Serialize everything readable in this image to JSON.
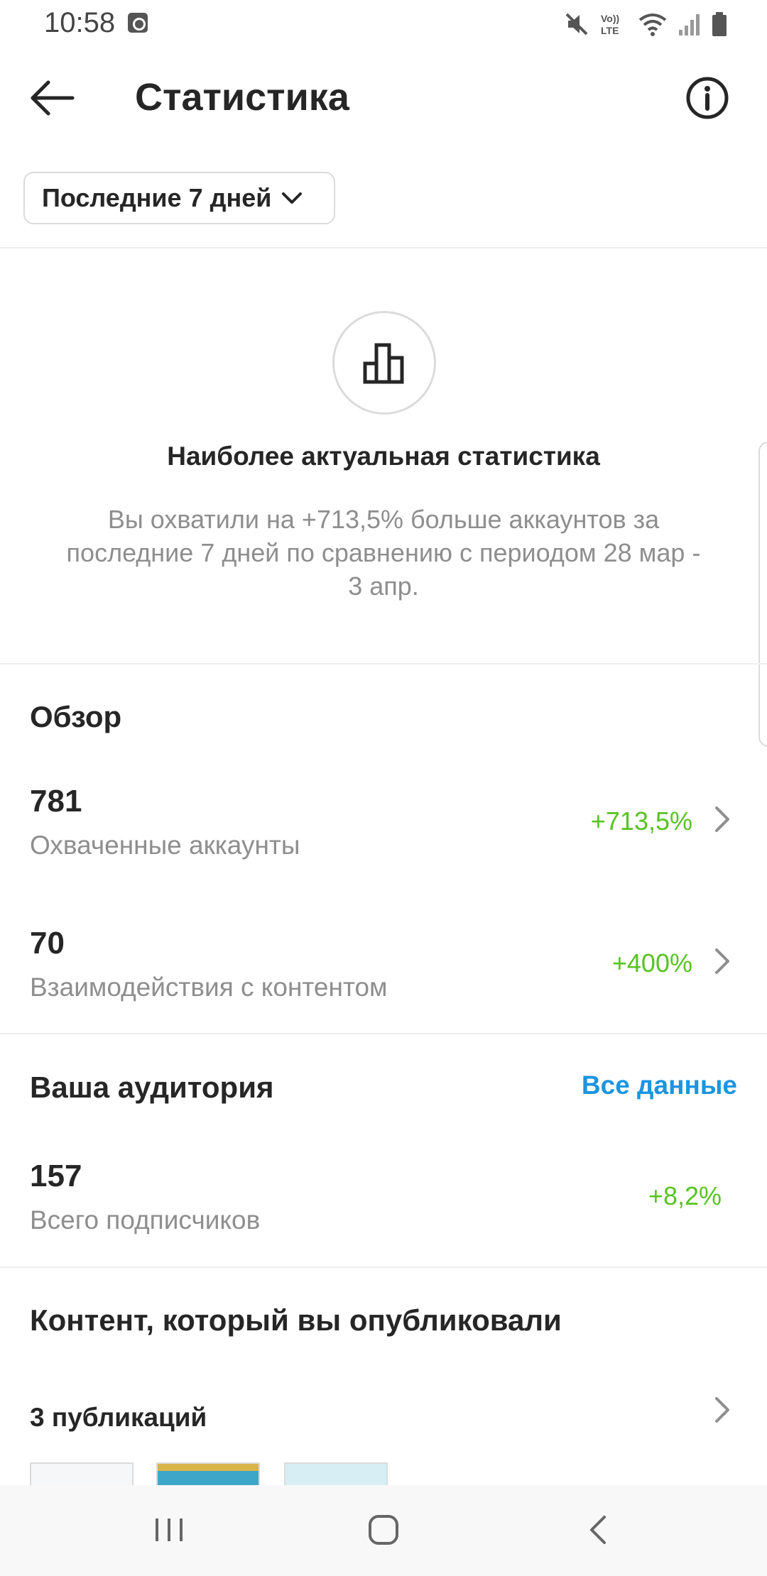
{
  "status_bar": {
    "time": "10:58",
    "icons": [
      "alarm-icon",
      "mute-icon",
      "volte-icon",
      "wifi-icon",
      "signal-icon",
      "battery-icon"
    ],
    "volte_text": "Vo))\nLTE"
  },
  "header": {
    "title": "Статистика",
    "back_icon": "arrow-left-icon",
    "info_icon": "info-icon"
  },
  "filter": {
    "period_label": "Последние 7 дней"
  },
  "highlight": {
    "icon": "bar-chart-icon",
    "title": "Наиболее актуальная статистика",
    "text": "Вы охватили на +713,5% больше аккаунтов за последние 7 дней по сравнению с периодом 28 мар - 3 апр."
  },
  "overview": {
    "title": "Обзор",
    "metrics": [
      {
        "value": "781",
        "label": "Охваченные аккаунты",
        "change": "+713,5%"
      },
      {
        "value": "70",
        "label": "Взаимодействия с контентом",
        "change": "+400%"
      }
    ]
  },
  "audience": {
    "title": "Ваша аудитория",
    "see_all": "Все данные",
    "metric": {
      "value": "157",
      "label": "Всего подписчиков",
      "change": "+8,2%"
    }
  },
  "content": {
    "title": "Контент, который вы опубликовали",
    "posts_count": "3 публикаций"
  },
  "colors": {
    "accent_link": "#1b95e0",
    "positive_change": "#58c322",
    "text_primary": "#262626",
    "text_secondary": "#8e8e8e"
  }
}
